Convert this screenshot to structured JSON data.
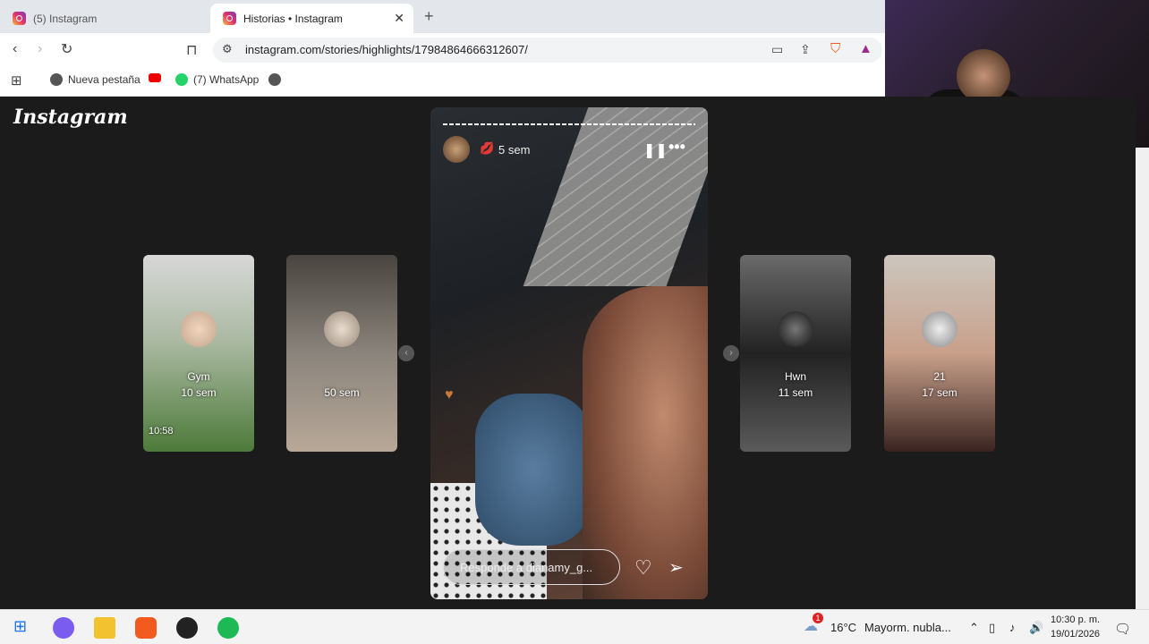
{
  "browser": {
    "tabs": [
      {
        "label": "(5) Instagram",
        "active": false
      },
      {
        "label": "Historias • Instagram",
        "active": true
      }
    ],
    "url": "instagram.com/stories/highlights/17984864666312607/",
    "bookmarks": [
      "Nueva pestaña",
      "(7) WhatsApp"
    ]
  },
  "page": {
    "logo": "Instagram",
    "story": {
      "time_ago": "5 sem",
      "reply_placeholder": "Responde a dianamy_g..."
    },
    "highlights": [
      {
        "title": "Gym",
        "time": "10 sem",
        "overlay_time": "10:58"
      },
      {
        "title": "",
        "time": "50 sem"
      },
      {
        "title": "Hwn",
        "time": "11 sem"
      },
      {
        "title": "21",
        "time": "17 sem"
      }
    ]
  },
  "taskbar": {
    "weather_temp": "16°C",
    "weather_desc": "Mayorm. nubla...",
    "clock_time": "10:30 p. m.",
    "clock_date": "19/01/2026",
    "notification_badge": "1"
  }
}
